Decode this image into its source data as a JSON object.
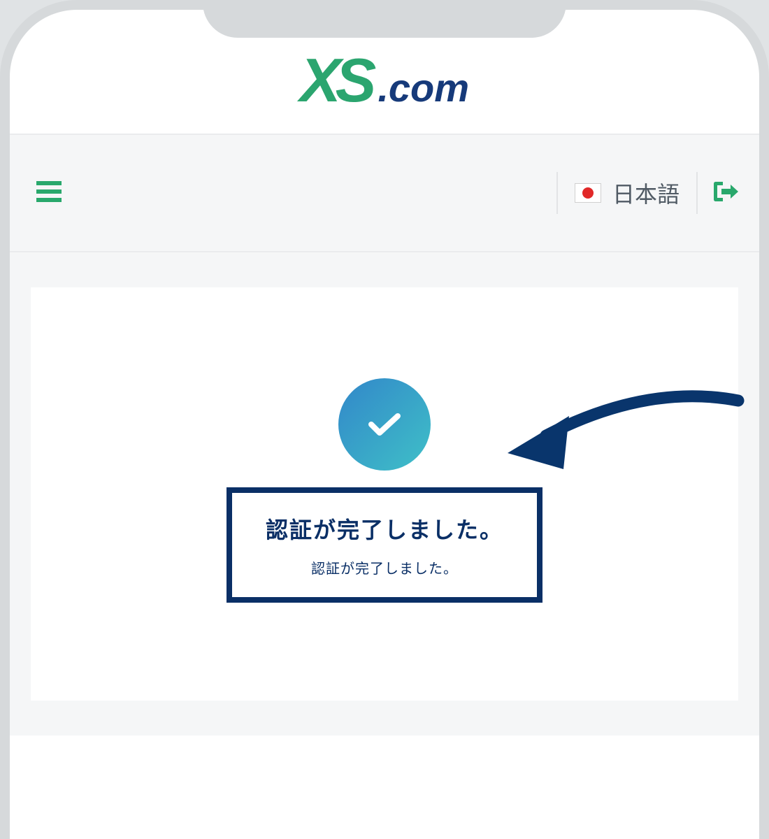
{
  "logo": {
    "part1": "XS",
    "part2": ".com"
  },
  "nav": {
    "language_label": "日本語"
  },
  "content": {
    "title": "認証が完了しました。",
    "subtitle": "認証が完了しました。"
  }
}
